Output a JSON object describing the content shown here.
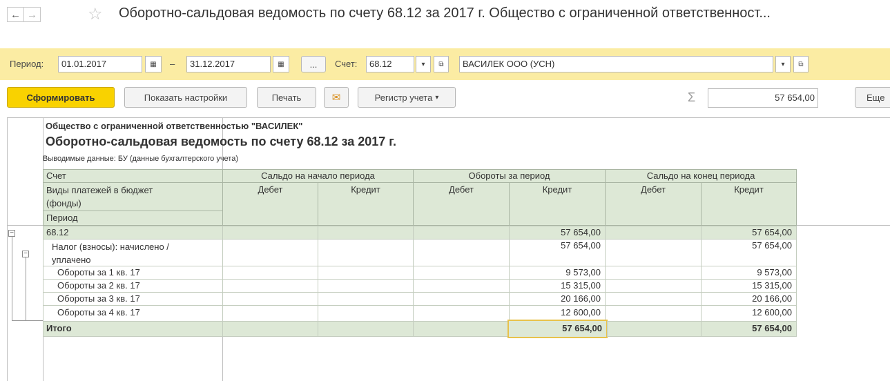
{
  "title": "Оборотно-сальдовая ведомость по счету 68.12 за 2017 г. Общество с ограниченной ответственност...",
  "filter": {
    "period_label": "Период:",
    "date_from": "01.01.2017",
    "dash": "–",
    "date_to": "31.12.2017",
    "more": "...",
    "account_label": "Счет:",
    "account": "68.12",
    "org": "ВАСИЛЕК ООО (УСН)"
  },
  "toolbar": {
    "generate": "Сформировать",
    "settings": "Показать настройки",
    "print": "Печать",
    "register": "Регистр учета",
    "sum_symbol": "Σ",
    "sum_value": "57 654,00",
    "more": "Еще"
  },
  "report": {
    "org_name": "Общество с ограниченной ответственностью \"ВАСИЛЕК\"",
    "heading": "Оборотно-сальдовая ведомость по счету 68.12 за 2017 г.",
    "output_data": "Выводимые данные:  БУ (данные бухгалтерского учета)",
    "header": {
      "account": "Счет",
      "payments_1": "Виды платежей в бюджет",
      "payments_2": "(фонды)",
      "period": "Период",
      "opening": "Сальдо на начало периода",
      "turnover": "Обороты за период",
      "closing": "Сальдо на конец периода",
      "debit": "Дебет",
      "credit": "Кредит"
    },
    "rows": [
      {
        "label": "68.12",
        "turn_credit": "57 654,00",
        "close_credit": "57 654,00"
      },
      {
        "label_1": "Налог (взносы): начислено /",
        "label_2": "уплачено",
        "turn_credit": "57 654,00",
        "close_credit": "57 654,00"
      },
      {
        "label": "Обороты за 1 кв. 17",
        "turn_credit": "9 573,00",
        "close_credit": "9 573,00"
      },
      {
        "label": "Обороты за 2 кв. 17",
        "turn_credit": "15 315,00",
        "close_credit": "15 315,00"
      },
      {
        "label": "Обороты за 3 кв. 17",
        "turn_credit": "20 166,00",
        "close_credit": "20 166,00"
      },
      {
        "label": "Обороты за 4 кв. 17",
        "turn_credit": "12 600,00",
        "close_credit": "12 600,00"
      }
    ],
    "total": {
      "label": "Итого",
      "turn_credit": "57 654,00",
      "close_credit": "57 654,00"
    }
  }
}
